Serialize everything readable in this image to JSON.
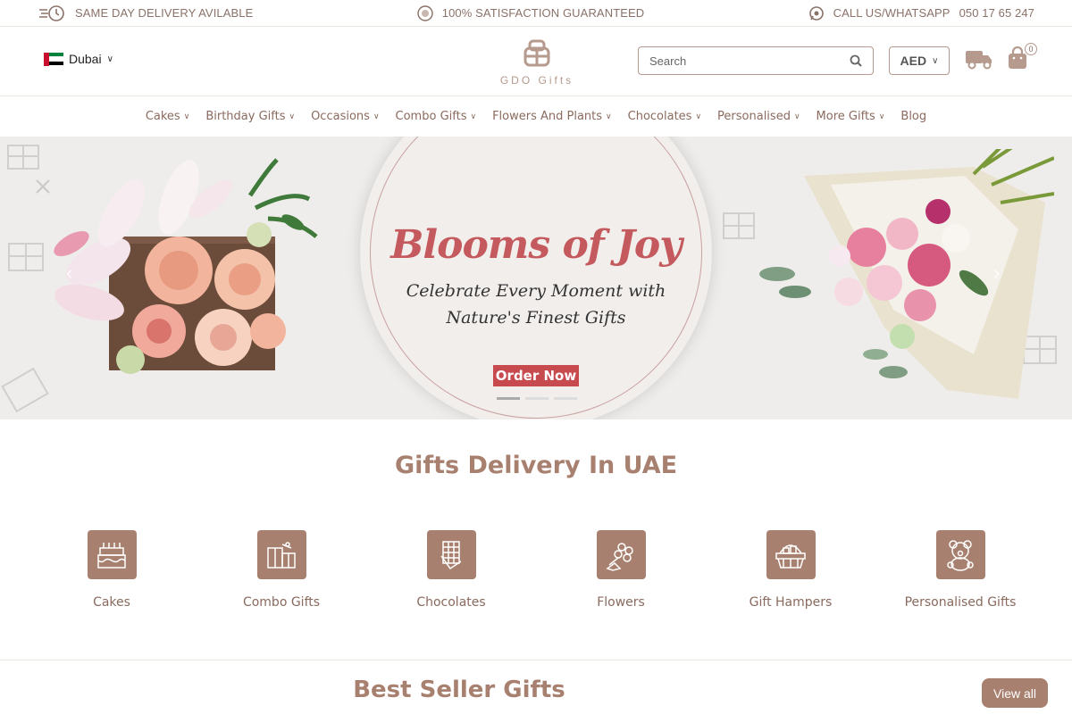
{
  "topbar": {
    "delivery": "SAME DAY DELIVERY AVILABLE",
    "guarantee": "100% SATISFACTION GUARANTEED",
    "call_label": "CALL US/WHATSAPP",
    "phone": "050 17 65 247"
  },
  "header": {
    "city": "Dubai",
    "logo_text": "GDO Gifts",
    "search_placeholder": "Search",
    "currency": "AED",
    "cart_count": "0"
  },
  "nav": [
    {
      "label": "Cakes",
      "has_dropdown": true
    },
    {
      "label": "Birthday Gifts",
      "has_dropdown": true
    },
    {
      "label": "Occasions",
      "has_dropdown": true
    },
    {
      "label": "Combo Gifts",
      "has_dropdown": true
    },
    {
      "label": "Flowers And Plants",
      "has_dropdown": true
    },
    {
      "label": "Chocolates",
      "has_dropdown": true
    },
    {
      "label": "Personalised",
      "has_dropdown": true
    },
    {
      "label": "More Gifts",
      "has_dropdown": true
    },
    {
      "label": "Blog",
      "has_dropdown": false
    }
  ],
  "hero": {
    "title": "Blooms of Joy",
    "subtitle_line1": "Celebrate Every Moment with",
    "subtitle_line2": "Nature's Finest Gifts",
    "cta": "Order Now"
  },
  "categories_section": {
    "title": "Gifts Delivery In UAE",
    "items": [
      {
        "label": "Cakes",
        "icon": "cake-icon"
      },
      {
        "label": "Combo Gifts",
        "icon": "gift-box-icon"
      },
      {
        "label": "Chocolates",
        "icon": "chocolate-bar-icon"
      },
      {
        "label": "Flowers",
        "icon": "bouquet-icon"
      },
      {
        "label": "Gift Hampers",
        "icon": "hamper-basket-icon"
      },
      {
        "label": "Personalised Gifts",
        "icon": "teddy-bear-icon"
      }
    ]
  },
  "bestseller": {
    "title": "Best Seller Gifts",
    "view_all": "View all"
  },
  "colors": {
    "brand": "#a8806f",
    "accent_red": "#c64a4e",
    "text_muted": "#8a6a5e"
  }
}
